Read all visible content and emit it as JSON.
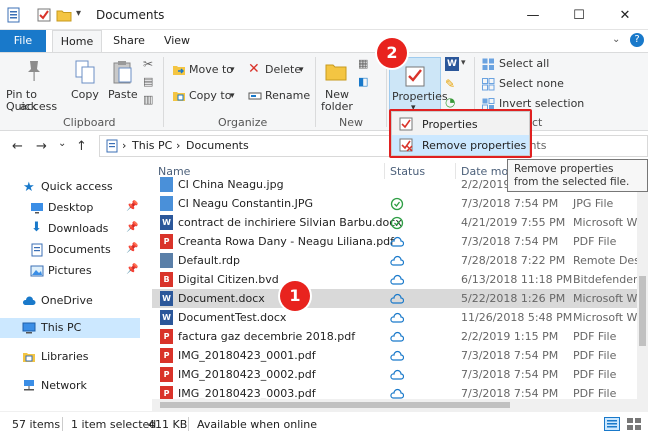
{
  "window": {
    "title": "Documents",
    "minimize_glyph": "—",
    "maximize_glyph": "☐",
    "close_glyph": "✕"
  },
  "tabs": [
    {
      "label": "File"
    },
    {
      "label": "Home"
    },
    {
      "label": "Share"
    },
    {
      "label": "View"
    }
  ],
  "ribbon": {
    "pin_label_1": "Pin to Quick",
    "pin_label_2": "access",
    "copy_label": "Copy",
    "paste_label": "Paste",
    "clipboard_group": "Clipboard",
    "move_to": "Move to",
    "copy_to": "Copy to",
    "delete": "Delete",
    "rename": "Rename",
    "organize_group": "Organize",
    "new_folder_1": "New",
    "new_folder_2": "folder",
    "new_group": "New",
    "properties": "Properties",
    "select_all": "Select all",
    "select_none": "Select none",
    "invert_selection": "Invert selection",
    "select_group_fragment": "ct",
    "dropdown_arrow": "▾"
  },
  "properties_menu": {
    "items": [
      {
        "label": "Properties"
      },
      {
        "label": "Remove properties"
      }
    ]
  },
  "tooltip": {
    "text": "Remove properties from the selected file."
  },
  "address": {
    "back": "←",
    "forward": "→",
    "recent": "⌄",
    "up": "↑",
    "sep1": "›",
    "crumb1": "This PC",
    "sep2": "›",
    "crumb2": "Documents",
    "search_placeholder": "uments"
  },
  "nav": {
    "items": [
      {
        "label": "Quick access"
      },
      {
        "label": "Desktop"
      },
      {
        "label": "Downloads"
      },
      {
        "label": "Documents"
      },
      {
        "label": "Pictures"
      },
      {
        "label": "OneDrive"
      },
      {
        "label": "This PC"
      },
      {
        "label": "Libraries"
      },
      {
        "label": "Network"
      }
    ],
    "pin_glyph": "📌"
  },
  "columns": {
    "name": "Name",
    "status": "Status",
    "date": "Date modi",
    "type": "Type"
  },
  "files": [
    {
      "name": "CI China Neagu.jpg",
      "date": "2/2/2019 1:15 PM",
      "type": "JPG File"
    },
    {
      "name": "CI Neagu Constantin.JPG",
      "date": "7/3/2018 7:54 PM",
      "type": "JPG File"
    },
    {
      "name": "contract de inchiriere Silvian Barbu.docx",
      "date": "4/21/2019 7:55 PM",
      "type": "Microsoft Wo"
    },
    {
      "name": "Creanta Rowa Dany - Neagu Liliana.pdf",
      "date": "7/3/2018 7:54 PM",
      "type": "PDF File"
    },
    {
      "name": "Default.rdp",
      "date": "7/28/2018 7:22 PM",
      "type": "Remote Deskt"
    },
    {
      "name": "Digital Citizen.bvd",
      "date": "6/13/2018 11:18 PM",
      "type": "Bitdefender F"
    },
    {
      "name": "Document.docx",
      "date": "5/22/2018 1:26 PM",
      "type": "Microsoft Wo"
    },
    {
      "name": "DocumentTest.docx",
      "date": "11/26/2018 5:48 PM",
      "type": "Microsoft Wo"
    },
    {
      "name": "factura gaz decembrie 2018.pdf",
      "date": "2/2/2019 1:15 PM",
      "type": "PDF File"
    },
    {
      "name": "IMG_20180423_0001.pdf",
      "date": "7/3/2018 7:54 PM",
      "type": "PDF File"
    },
    {
      "name": "IMG_20180423_0002.pdf",
      "date": "7/3/2018 7:54 PM",
      "type": "PDF File"
    },
    {
      "name": "IMG_20180423_0003.pdf",
      "date": "7/3/2018 7:54 PM",
      "type": "PDF File"
    }
  ],
  "status": {
    "items_count": "57 items",
    "selected": "1 item selected",
    "size": "411 KB",
    "availability": "Available when online"
  },
  "callouts": {
    "one": "1",
    "two": "2"
  },
  "colors": {
    "accent": "#1979ca",
    "callout": "#e8231e",
    "pdf": "#d9332a",
    "word": "#2b579a"
  }
}
